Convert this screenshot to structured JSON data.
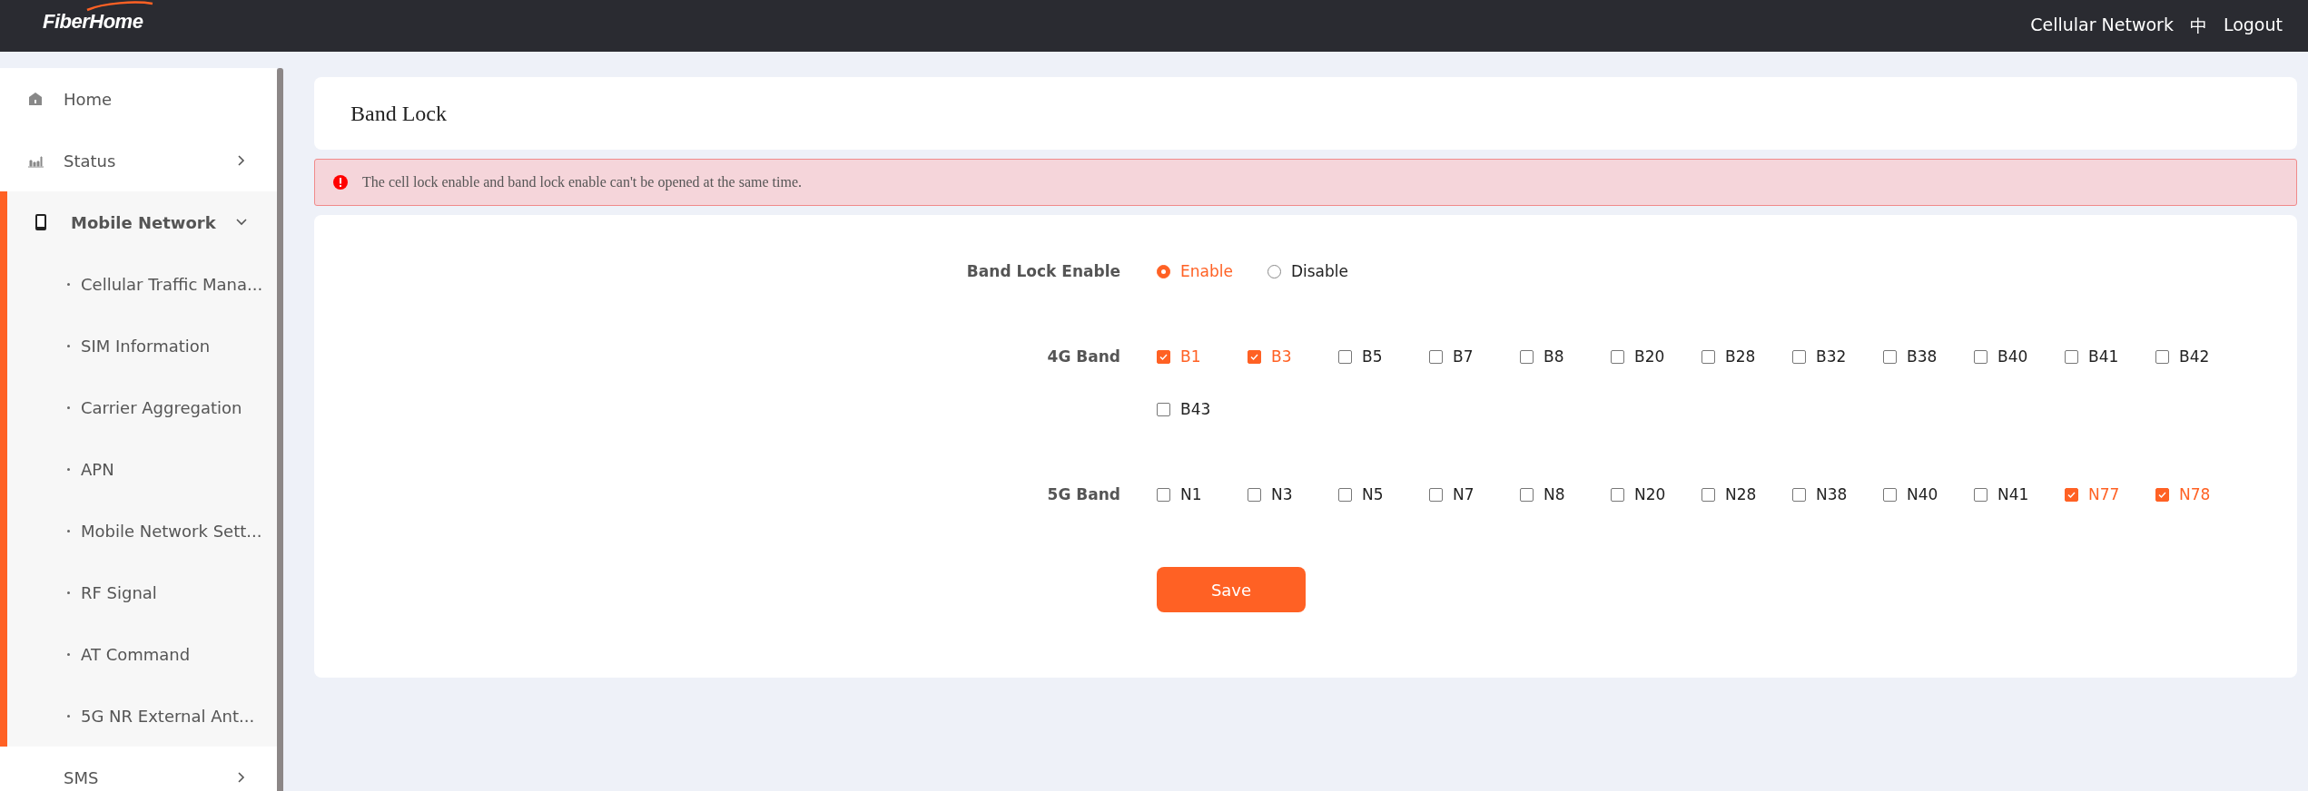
{
  "header": {
    "logo": "FiberHome",
    "links": [
      {
        "label": "Cellular Network"
      },
      {
        "label": "中"
      },
      {
        "label": "Logout"
      }
    ]
  },
  "sidebar": {
    "items": [
      {
        "label": "Home",
        "selected": false
      },
      {
        "label": "Status",
        "selected": false,
        "expanded": false
      },
      {
        "label": "Mobile Network",
        "selected": true,
        "expanded": true,
        "children": [
          {
            "label": "Cellular Traffic Mana..."
          },
          {
            "label": "SIM Information"
          },
          {
            "label": "Carrier Aggregation"
          },
          {
            "label": "APN"
          },
          {
            "label": "Mobile Network Sett..."
          },
          {
            "label": "RF Signal"
          },
          {
            "label": "AT Command"
          },
          {
            "label": "5G NR External Ant..."
          }
        ]
      },
      {
        "label": "SMS",
        "selected": false,
        "expanded": false
      }
    ]
  },
  "page_title": "Band Lock",
  "alert": "The cell lock enable and band lock enable can't be opened at the same time.",
  "form": {
    "enable": {
      "label": "Band Lock Enable",
      "options": [
        {
          "label": "Enable",
          "selected": true
        },
        {
          "label": "Disable",
          "selected": false
        }
      ]
    },
    "bands": [
      {
        "label": "4G Band",
        "items": [
          {
            "label": "B1",
            "checked": true
          },
          {
            "label": "B3",
            "checked": true
          },
          {
            "label": "B5",
            "checked": false
          },
          {
            "label": "B7",
            "checked": false
          },
          {
            "label": "B8",
            "checked": false
          },
          {
            "label": "B20",
            "checked": false
          },
          {
            "label": "B28",
            "checked": false
          },
          {
            "label": "B32",
            "checked": false
          },
          {
            "label": "B38",
            "checked": false
          },
          {
            "label": "B40",
            "checked": false
          },
          {
            "label": "B41",
            "checked": false
          },
          {
            "label": "B42",
            "checked": false
          },
          {
            "label": "B43",
            "checked": false
          }
        ]
      },
      {
        "label": "5G Band",
        "items": [
          {
            "label": "N1",
            "checked": false
          },
          {
            "label": "N3",
            "checked": false
          },
          {
            "label": "N5",
            "checked": false
          },
          {
            "label": "N7",
            "checked": false
          },
          {
            "label": "N8",
            "checked": false
          },
          {
            "label": "N20",
            "checked": false
          },
          {
            "label": "N28",
            "checked": false
          },
          {
            "label": "N38",
            "checked": false
          },
          {
            "label": "N40",
            "checked": false
          },
          {
            "label": "N41",
            "checked": false
          },
          {
            "label": "N77",
            "checked": true
          },
          {
            "label": "N78",
            "checked": true
          }
        ]
      }
    ],
    "save": "Save"
  }
}
